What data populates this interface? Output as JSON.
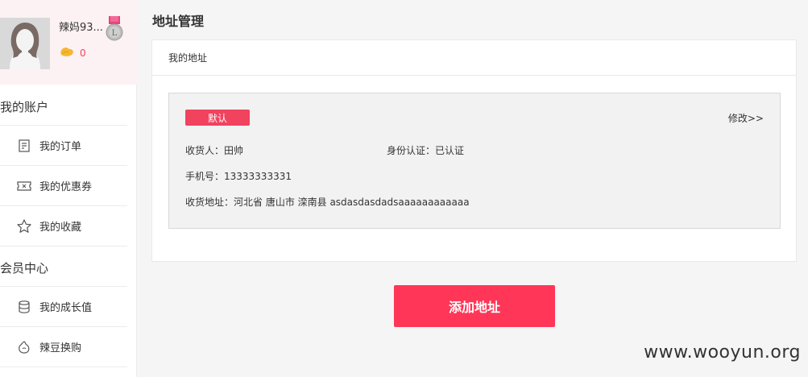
{
  "sidebar": {
    "username": "辣妈93...",
    "beans_count": "0",
    "sections": [
      {
        "title": "我的账户",
        "items": [
          {
            "label": "我的订单",
            "icon": "order-icon"
          },
          {
            "label": "我的优惠券",
            "icon": "coupon-icon"
          },
          {
            "label": "我的收藏",
            "icon": "star-icon"
          }
        ]
      },
      {
        "title": "会员中心",
        "items": [
          {
            "label": "我的成长值",
            "icon": "growth-icon"
          },
          {
            "label": "辣豆换购",
            "icon": "bean-exchange-icon"
          }
        ]
      }
    ],
    "medal_letter": "L"
  },
  "page": {
    "title": "地址管理"
  },
  "address_card": {
    "header": "我的地址",
    "default_badge": "默认",
    "edit_link": "修改>>",
    "recipient": "收货人：田帅",
    "id_verify": "身份认证：已认证",
    "phone": "手机号：13333333331",
    "address": "收货地址：河北省 唐山市 滦南县 asdasdasdadsaaaaaaaaaaaa"
  },
  "actions": {
    "add_address": "添加地址"
  },
  "watermark": "www.wooyun.org",
  "colors": {
    "accent": "#ff3657",
    "badge": "#f1425e",
    "profile_bg": "#fdf2f3"
  }
}
